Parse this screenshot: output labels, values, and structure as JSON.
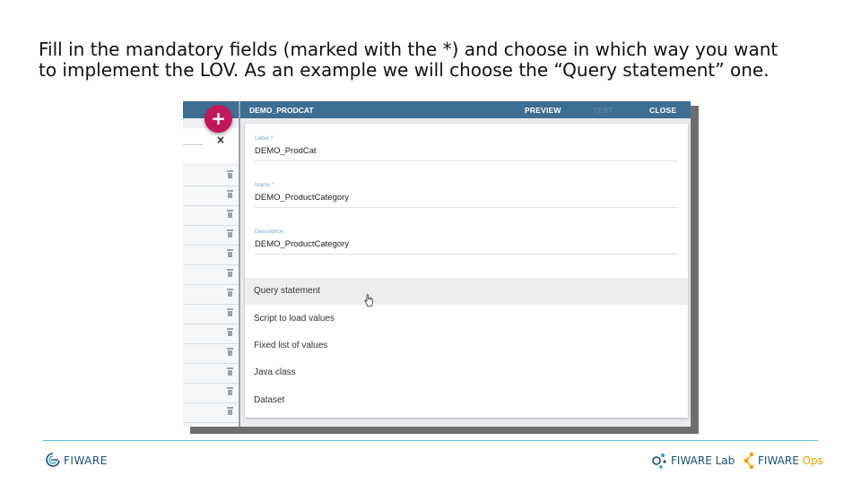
{
  "instruction": {
    "line1": "Fill in the mandatory fields (marked with the *) and choose in which way you want",
    "line2": "to implement the LOV. As an example we will choose the “Query statement” one."
  },
  "toolbar": {
    "title": "DEMO_PRODCAT",
    "preview": "PREVIEW",
    "test": "TEST",
    "close": "CLOSE"
  },
  "fab": {
    "label": "+"
  },
  "search": {
    "clear": "×"
  },
  "form": {
    "label": {
      "label": "Label *",
      "value": "DEMO_ProdCat"
    },
    "name": {
      "label": "Name *",
      "value": "DEMO_ProductCategory"
    },
    "description": {
      "label": "Description",
      "value": "DEMO_ProductCategory"
    }
  },
  "lov_options": [
    "Query statement",
    "Script to load values",
    "Fixed list of values",
    "Java class",
    "Dataset"
  ],
  "selected_option": "Query statement",
  "footer": {
    "fiware": "FIWARE",
    "lab": "FIWARE Lab",
    "ops_brand": "FIWARE",
    "ops_suffix": "Ops"
  },
  "colors": {
    "toolbar": "#3f6e93",
    "fab": "#c2185b",
    "accent_line": "#5fc3d2",
    "ops_orange": "#f0a200"
  }
}
